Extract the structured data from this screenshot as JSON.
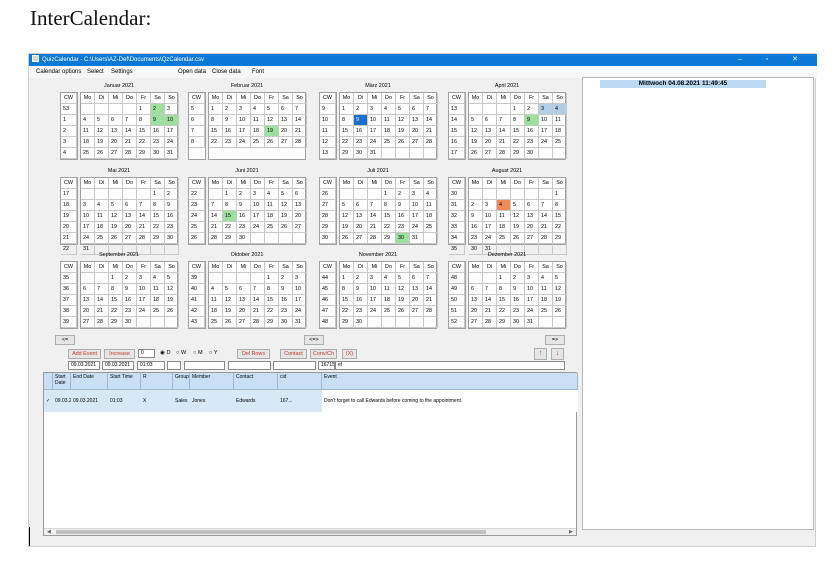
{
  "document_title": "InterCalendar:",
  "window": {
    "title": "QuizCalendar - C:\\Users\\AZ-Def\\Documents\\QzCalendar.csv",
    "controls": {
      "minimize": "–",
      "maximize": "▫",
      "close": "✕"
    }
  },
  "menu": [
    "Calendar options",
    "Select",
    "Settings",
    "Open data",
    "Close data",
    "Font"
  ],
  "weekday_headers": [
    "CW",
    "Mo",
    "Di",
    "Mi",
    "Do",
    "Fr",
    "Sa",
    "So"
  ],
  "months": [
    {
      "title": "Januar 2021",
      "rows": [
        [
          "53",
          "",
          "",
          "",
          "",
          "1",
          "2",
          "3"
        ],
        [
          "1",
          "4",
          "5",
          "6",
          "7",
          "8",
          "9",
          "10"
        ],
        [
          "2",
          "11",
          "12",
          "13",
          "14",
          "15",
          "16",
          "17"
        ],
        [
          "3",
          "18",
          "19",
          "20",
          "21",
          "22",
          "23",
          "24"
        ],
        [
          "4",
          "25",
          "26",
          "27",
          "28",
          "29",
          "30",
          "31"
        ]
      ]
    },
    {
      "title": "Februar 2021",
      "rows": [
        [
          "5",
          "1",
          "2",
          "3",
          "4",
          "5",
          "6",
          "7"
        ],
        [
          "6",
          "8",
          "9",
          "10",
          "11",
          "12",
          "13",
          "14"
        ],
        [
          "7",
          "15",
          "16",
          "17",
          "18",
          "19",
          "20",
          "21"
        ],
        [
          "8",
          "22",
          "23",
          "24",
          "25",
          "26",
          "27",
          "28"
        ]
      ]
    },
    {
      "title": "März 2021",
      "rows": [
        [
          "9",
          "1",
          "2",
          "3",
          "4",
          "5",
          "6",
          "7"
        ],
        [
          "10",
          "8",
          "9",
          "10",
          "11",
          "12",
          "13",
          "14"
        ],
        [
          "11",
          "15",
          "16",
          "17",
          "18",
          "19",
          "20",
          "21"
        ],
        [
          "12",
          "22",
          "23",
          "24",
          "25",
          "26",
          "27",
          "28"
        ],
        [
          "13",
          "29",
          "30",
          "31",
          "",
          "",
          "",
          ""
        ]
      ]
    },
    {
      "title": "April 2021",
      "rows": [
        [
          "13",
          "",
          "",
          "",
          "1",
          "2",
          "3",
          "4"
        ],
        [
          "14",
          "5",
          "6",
          "7",
          "8",
          "9",
          "10",
          "11"
        ],
        [
          "15",
          "12",
          "13",
          "14",
          "15",
          "16",
          "17",
          "18"
        ],
        [
          "16",
          "19",
          "20",
          "21",
          "22",
          "23",
          "24",
          "25"
        ],
        [
          "17",
          "26",
          "27",
          "28",
          "29",
          "30",
          "",
          ""
        ]
      ]
    },
    {
      "title": "Mai 2021",
      "rows": [
        [
          "17",
          "",
          "",
          "",
          "",
          "",
          "1",
          "2"
        ],
        [
          "18",
          "3",
          "4",
          "5",
          "6",
          "7",
          "8",
          "9"
        ],
        [
          "19",
          "10",
          "11",
          "12",
          "13",
          "14",
          "15",
          "16"
        ],
        [
          "20",
          "17",
          "18",
          "19",
          "20",
          "21",
          "22",
          "23"
        ],
        [
          "21",
          "24",
          "25",
          "26",
          "27",
          "28",
          "29",
          "30"
        ],
        [
          "22",
          "31",
          "",
          "",
          "",
          "",
          "",
          ""
        ]
      ]
    },
    {
      "title": "Juni 2021",
      "rows": [
        [
          "22",
          "",
          "1",
          "2",
          "3",
          "4",
          "5",
          "6"
        ],
        [
          "23",
          "7",
          "8",
          "9",
          "10",
          "11",
          "12",
          "13"
        ],
        [
          "24",
          "14",
          "15",
          "16",
          "17",
          "18",
          "19",
          "20"
        ],
        [
          "25",
          "21",
          "22",
          "23",
          "24",
          "25",
          "26",
          "27"
        ],
        [
          "26",
          "28",
          "29",
          "30",
          "",
          "",
          "",
          ""
        ]
      ]
    },
    {
      "title": "Juli 2021",
      "rows": [
        [
          "26",
          "",
          "",
          "",
          "1",
          "2",
          "3",
          "4"
        ],
        [
          "27",
          "5",
          "6",
          "7",
          "8",
          "9",
          "10",
          "11"
        ],
        [
          "28",
          "12",
          "13",
          "14",
          "15",
          "16",
          "17",
          "18"
        ],
        [
          "29",
          "19",
          "20",
          "21",
          "22",
          "23",
          "24",
          "25"
        ],
        [
          "30",
          "26",
          "27",
          "28",
          "29",
          "30",
          "31",
          ""
        ]
      ]
    },
    {
      "title": "August 2021",
      "rows": [
        [
          "30",
          "",
          "",
          "",
          "",
          "",
          "",
          "1"
        ],
        [
          "31",
          "2",
          "3",
          "4",
          "5",
          "6",
          "7",
          "8"
        ],
        [
          "32",
          "9",
          "10",
          "11",
          "12",
          "13",
          "14",
          "15"
        ],
        [
          "33",
          "16",
          "17",
          "18",
          "19",
          "20",
          "21",
          "22"
        ],
        [
          "34",
          "23",
          "24",
          "25",
          "26",
          "27",
          "28",
          "29"
        ],
        [
          "35",
          "30",
          "31",
          "",
          "",
          "",
          "",
          ""
        ]
      ]
    },
    {
      "title": "September 2021",
      "rows": [
        [
          "35",
          "",
          "",
          "1",
          "2",
          "3",
          "4",
          "5"
        ],
        [
          "36",
          "6",
          "7",
          "8",
          "9",
          "10",
          "11",
          "12"
        ],
        [
          "37",
          "13",
          "14",
          "15",
          "16",
          "17",
          "18",
          "19"
        ],
        [
          "38",
          "20",
          "21",
          "22",
          "23",
          "24",
          "25",
          "26"
        ],
        [
          "39",
          "27",
          "28",
          "29",
          "30",
          "",
          "",
          ""
        ]
      ]
    },
    {
      "title": "Oktober 2021",
      "rows": [
        [
          "39",
          "",
          "",
          "",
          "",
          "1",
          "2",
          "3"
        ],
        [
          "40",
          "4",
          "5",
          "6",
          "7",
          "8",
          "9",
          "10"
        ],
        [
          "41",
          "11",
          "12",
          "13",
          "14",
          "15",
          "16",
          "17"
        ],
        [
          "42",
          "18",
          "19",
          "20",
          "21",
          "22",
          "23",
          "24"
        ],
        [
          "43",
          "25",
          "26",
          "27",
          "28",
          "29",
          "30",
          "31"
        ]
      ]
    },
    {
      "title": "November 2021",
      "rows": [
        [
          "44",
          "1",
          "2",
          "3",
          "4",
          "5",
          "6",
          "7"
        ],
        [
          "45",
          "8",
          "9",
          "10",
          "11",
          "12",
          "13",
          "14"
        ],
        [
          "46",
          "15",
          "16",
          "17",
          "18",
          "19",
          "20",
          "21"
        ],
        [
          "47",
          "22",
          "23",
          "24",
          "25",
          "26",
          "27",
          "28"
        ],
        [
          "48",
          "29",
          "30",
          "",
          "",
          "",
          "",
          ""
        ]
      ]
    },
    {
      "title": "Dezember 2021",
      "rows": [
        [
          "48",
          "",
          "",
          "1",
          "2",
          "3",
          "4",
          "5"
        ],
        [
          "49",
          "6",
          "7",
          "8",
          "9",
          "10",
          "11",
          "12"
        ],
        [
          "50",
          "13",
          "14",
          "15",
          "16",
          "17",
          "18",
          "19"
        ],
        [
          "51",
          "20",
          "21",
          "22",
          "23",
          "24",
          "25",
          "26"
        ],
        [
          "52",
          "27",
          "28",
          "29",
          "30",
          "31",
          "",
          ""
        ]
      ]
    }
  ],
  "highlights": [
    {
      "month": 0,
      "row": 0,
      "col": 6,
      "color": "green"
    },
    {
      "month": 0,
      "row": 1,
      "col": 6,
      "color": "green"
    },
    {
      "month": 0,
      "row": 1,
      "col": 7,
      "color": "green"
    },
    {
      "month": 1,
      "row": 2,
      "col": 5,
      "color": "green"
    },
    {
      "month": 2,
      "row": 1,
      "col": 2,
      "color": "blue"
    },
    {
      "month": 3,
      "row": 0,
      "col": 6,
      "color": "lblue"
    },
    {
      "month": 3,
      "row": 0,
      "col": 7,
      "color": "lblue"
    },
    {
      "month": 3,
      "row": 1,
      "col": 5,
      "color": "green"
    },
    {
      "month": 5,
      "row": 2,
      "col": 2,
      "color": "green"
    },
    {
      "month": 6,
      "row": 4,
      "col": 5,
      "color": "green"
    },
    {
      "month": 7,
      "row": 1,
      "col": 3,
      "color": "orange"
    }
  ],
  "colors": {
    "green": "#9de09b",
    "blue": "#1b6fcc",
    "lblue": "#b3cfe6",
    "orange": "#f08a5a",
    "titlebar": "#0a78d7",
    "header_blue": "#c9e0f4"
  },
  "nav": {
    "prev": "<=",
    "center": "<=>",
    "next": "=>"
  },
  "buttons": {
    "add_event": "Add Event",
    "increase": "Increase",
    "del_rows": "Del Rows",
    "contact": "Contact",
    "conv": "Conv/Ch",
    "x": "(X)",
    "up": "↑",
    "down": "↓"
  },
  "increase_value": "0",
  "radio_options": [
    "D",
    "W",
    "M",
    "Y"
  ],
  "radio_selected": "D",
  "fields": {
    "start_date": "09.03.2021",
    "end_date": "09.03.2021",
    "time": "01:03",
    "r": "",
    "group": "",
    "member": "",
    "contact": "",
    "cid": "16715",
    "event": "ef"
  },
  "table": {
    "columns": [
      "",
      "Start Date",
      "End Date",
      "Start Time",
      "R",
      "Group",
      "Member",
      "Contact",
      "cid",
      "Event"
    ],
    "rows": [
      [
        "✓",
        "09.03.2021",
        "09.03.2021",
        "01:03",
        "X",
        "Sales",
        "Jones",
        "Edwards",
        "167...",
        "Don't forget to call Edwards before coming to the appointment."
      ]
    ]
  },
  "datetime": "Mittwoch   04.08.2021 11:49:45"
}
